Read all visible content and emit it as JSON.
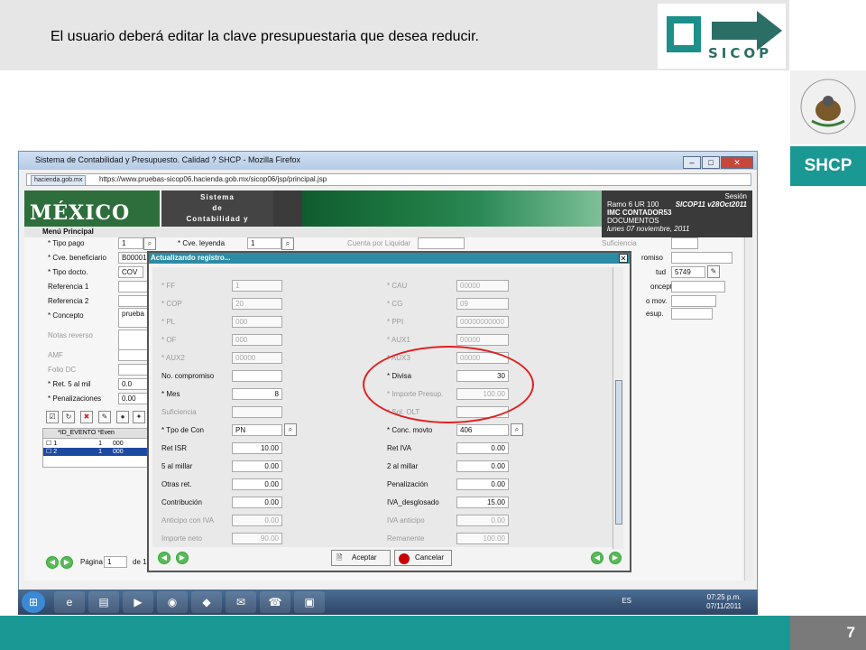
{
  "slide": {
    "title": "El usuario  deberá  editar  la clave  presupuestaria  que desea reducir.",
    "page_number": "7",
    "brand": "SHCP",
    "logo_text": "SICOP"
  },
  "browser": {
    "window_title": "Sistema de Contabilidad y Presupuesto. Calidad ? SHCP - Mozilla Firefox",
    "domain_badge": "hacienda.gob.mx",
    "url": "https://www.pruebas-sicop06.hacienda.gob.mx/sicop06/jsp/principal.jsp"
  },
  "banner": {
    "mexico": "MÉXICO",
    "system_line1": "Sistema",
    "system_line2": "de",
    "system_line3": "Contabilidad y Presupuesto",
    "menu": "Menú Principal",
    "session": "Sesión",
    "ramo": "Ramo  6  UR 100",
    "version": "SICOP11  v28Oct2011",
    "user": "IMC CONTADOR53",
    "section": "DOCUMENTOS",
    "date": "lunes 07 noviembre, 2011"
  },
  "form": {
    "tipo_pago_label": "* Tipo pago",
    "tipo_pago": "1",
    "cve_leyenda_label": "* Cve. leyenda",
    "cve_leyenda": "1",
    "cuenta_liquidar_label": "Cuenta por Liquidar",
    "suficiencia_label": "Suficiencia",
    "cve_benef_label": "* Cve. beneficiario",
    "cve_benef": "B00001",
    "compromiso_label": "romiso",
    "tipo_docto_label": "* Tipo docto.",
    "tipo_docto": "COV",
    "solicitud_label": "tud",
    "solicitud": "5749",
    "ref1_label": "Referencia 1",
    "ref2_label": "Referencia 2",
    "concepto_r_label": "oncepto",
    "mov_label": "o mov.",
    "concepto_label": "* Concepto",
    "concepto": "prueba",
    "presup_label": "esup.",
    "notas_label": "Notas reverso",
    "amf_label": "AMF",
    "folio_label": "Folio DC",
    "ret5_label": "* Ret. 5 al mil",
    "ret5": "0.0",
    "penal_label": "* Penalizaciones",
    "penal": "0.00"
  },
  "grid": {
    "col1": "*ID_EVENTO",
    "col2": "*Even",
    "rows": [
      {
        "id": "1",
        "ev": "000"
      },
      {
        "id": "1",
        "ev": "000"
      }
    ],
    "row_nums": [
      "1",
      "2"
    ]
  },
  "pager": {
    "label": "Página",
    "value": "1",
    "of": "de 1"
  },
  "modal": {
    "title": "Actualizando registro...",
    "left": [
      {
        "label": "* FF",
        "value": "1",
        "disabled": true
      },
      {
        "label": "* COP",
        "value": "20",
        "disabled": true
      },
      {
        "label": "* PL",
        "value": "000",
        "disabled": true
      },
      {
        "label": "* OF",
        "value": "000",
        "disabled": true
      },
      {
        "label": "* AUX2",
        "value": "00000",
        "disabled": true
      },
      {
        "label": "No. compromiso",
        "value": "",
        "disabled": false
      },
      {
        "label": "* Mes",
        "value": "8",
        "disabled": false
      },
      {
        "label": "Suficiencia",
        "value": "",
        "disabled": true
      },
      {
        "label": "* Tpo de Con",
        "value": "PN",
        "disabled": false
      },
      {
        "label": "Ret ISR",
        "value": "10.00",
        "disabled": false
      },
      {
        "label": "5 al millar",
        "value": "0.00",
        "disabled": false
      },
      {
        "label": "Otras ret.",
        "value": "0.00",
        "disabled": false
      },
      {
        "label": "Contribución",
        "value": "0.00",
        "disabled": false
      },
      {
        "label": "Anticipo con IVA",
        "value": "0.00",
        "disabled": true
      },
      {
        "label": "Importe neto",
        "value": "90.00",
        "disabled": true
      }
    ],
    "right": [
      {
        "label": "* CAU",
        "value": "00000",
        "disabled": true
      },
      {
        "label": "* CG",
        "value": "09",
        "disabled": true
      },
      {
        "label": "* PPI",
        "value": "00000000000",
        "disabled": true
      },
      {
        "label": "* AUX1",
        "value": "00000",
        "disabled": true
      },
      {
        "label": "* AUX3",
        "value": "00000",
        "disabled": true
      },
      {
        "label": "* Divisa",
        "value": "30",
        "disabled": false
      },
      {
        "label": "* Importe Presup.",
        "value": "100.00",
        "disabled": true
      },
      {
        "label": "* Sol. OLT",
        "value": "",
        "disabled": true
      },
      {
        "label": "* Conc. movto",
        "value": "406",
        "disabled": false
      },
      {
        "label": "Ret IVA",
        "value": "0.00",
        "disabled": false
      },
      {
        "label": "2 al millar",
        "value": "0.00",
        "disabled": false
      },
      {
        "label": "Penalización",
        "value": "0.00",
        "disabled": false
      },
      {
        "label": "IVA_desglosado",
        "value": "15.00",
        "disabled": false
      },
      {
        "label": "IVA anticipo",
        "value": "0.00",
        "disabled": true
      },
      {
        "label": "Remanente",
        "value": "100.00",
        "disabled": true
      }
    ],
    "accept": "Aceptar",
    "cancel": "Cancelar"
  },
  "taskbar": {
    "lang": "ES",
    "time": "07:25 p.m.",
    "date": "07/11/2011"
  },
  "colors": {
    "teal": "#1a9893",
    "gray": "#7a7a7a",
    "highlight": "#e02020",
    "mexico_green": "#2e6e3c"
  }
}
